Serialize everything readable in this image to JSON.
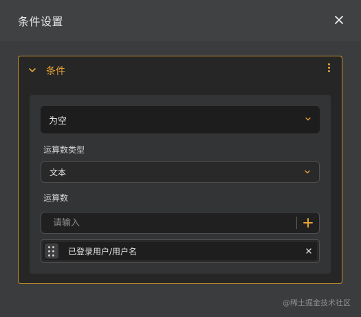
{
  "dialog": {
    "title": "条件设置",
    "close_icon": "close-icon"
  },
  "condition": {
    "title": "条件",
    "collapse_icon": "chevron-down-icon",
    "more_icon": "more-vertical-icon",
    "operator": {
      "selected": "为空"
    },
    "operand_type": {
      "label": "运算数类型",
      "selected": "文本"
    },
    "operand": {
      "label": "运算数",
      "placeholder": "请输入",
      "tags": [
        {
          "text": "已登录用户/用户名",
          "remove_label": "x"
        }
      ]
    }
  },
  "watermark": "@稀土掘金技术社区",
  "colors": {
    "accent": "#e8a33a",
    "border_accent": "#c7922d",
    "background": "#3a3b3d"
  }
}
